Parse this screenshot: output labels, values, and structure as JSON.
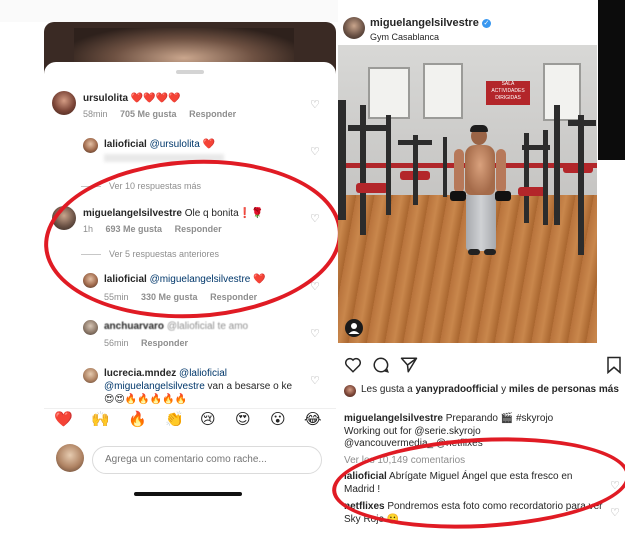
{
  "left_panel": {
    "comments": [
      {
        "user": "ursulolita",
        "text": "❤️❤️❤️❤️",
        "time": "58min",
        "likes": "705 Me gusta",
        "reply": "Responder"
      },
      {
        "user": "lalioficial",
        "mention": "@ursulolita",
        "text": "❤️",
        "time": "",
        "likes": "",
        "reply": ""
      },
      {
        "user": "miguelangelsilvestre",
        "text": "Ole q bonita❗🌹",
        "time": "1h",
        "likes": "693 Me gusta",
        "reply": "Responder"
      },
      {
        "user": "lalioficial",
        "mention": "@miguelangelsilvestre",
        "text": "❤️",
        "time": "55min",
        "likes": "330 Me gusta",
        "reply": "Responder"
      },
      {
        "user": "anchuarvaro",
        "text": "@lalioficial te amo",
        "time": "56min",
        "likes": "",
        "reply": "Responder"
      },
      {
        "user": "lucrecia.mndez",
        "mention": "@lalioficial",
        "text2_mention": "@miguelangelsilvestre",
        "text": "van a besarse o ke",
        "emojis": "😍😍🔥🔥🔥🔥🔥"
      }
    ],
    "view_more_replies": "Ver 10 respuestas más",
    "view_previous_replies": "Ver 5 respuestas anteriores",
    "emoji_bar": [
      "❤️",
      "🙌",
      "🔥",
      "👏",
      "😢",
      "😍",
      "😮",
      "😂"
    ],
    "comment_placeholder": "Agrega un comentario como rache..."
  },
  "right_panel": {
    "post_user": "miguelangelsilvestre",
    "post_location": "Gym Casablanca",
    "gym_sign": "SALA ACTIVIDADES DIRIGIDAS",
    "likes_line": "Les gusta a yanypradoofficial y miles de personas más",
    "likes_user": "yanypradoofficial",
    "likes_bold_rest": "miles de personas más",
    "caption_user": "miguelangelsilvestre",
    "caption_text": "Preparando 🎬 #skyrojo",
    "caption_line2": "Working out for @serie.skyrojo",
    "caption_line3": "@vancouvermedia_ @netflixes",
    "view_comments": "Ver los 10,149 comentarios",
    "comments": [
      {
        "user": "lalioficial",
        "text": "Abrígate Miguel Ángel que esta fresco en Madrid !"
      },
      {
        "user": "netflixes",
        "text": "Pondremos esta foto como recordatorio para ver Sky Rojo 🙂"
      }
    ]
  },
  "colors": {
    "annotation_red": "#e01b24",
    "heart_red": "#e0162b",
    "link_blue": "#00376b",
    "verified_blue": "#3897f0"
  }
}
